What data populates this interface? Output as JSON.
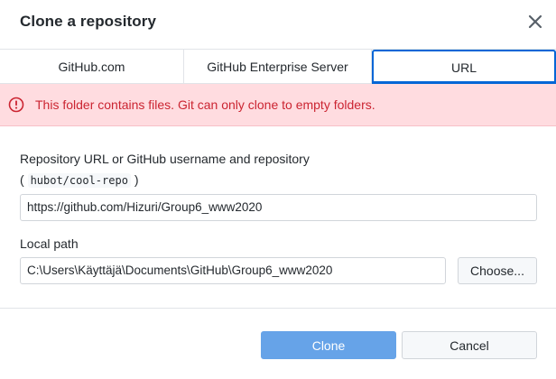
{
  "dialog": {
    "title": "Clone a repository",
    "close_icon": "close-icon"
  },
  "tabs": [
    {
      "label": "GitHub.com",
      "selected": false
    },
    {
      "label": "GitHub Enterprise Server",
      "selected": false
    },
    {
      "label": "URL",
      "selected": true
    }
  ],
  "error": {
    "icon": "alert-circle-icon",
    "message": "This folder contains files. Git can only clone to empty folders."
  },
  "repo_url": {
    "label": "Repository URL or GitHub username and repository",
    "hint_open": "(",
    "hint_code": "hubot/cool-repo",
    "hint_close": ")",
    "value": "https://github.com/Hizuri/Group6_www2020"
  },
  "local_path": {
    "label": "Local path",
    "value": "C:\\Users\\Käyttäjä\\Documents\\GitHub\\Group6_www2020",
    "choose_label": "Choose..."
  },
  "footer": {
    "clone_label": "Clone",
    "cancel_label": "Cancel"
  },
  "colors": {
    "accent": "#0366d6",
    "error_bg": "#ffdce0",
    "error_text": "#cb2431",
    "clone_button": "#66a3e8"
  }
}
